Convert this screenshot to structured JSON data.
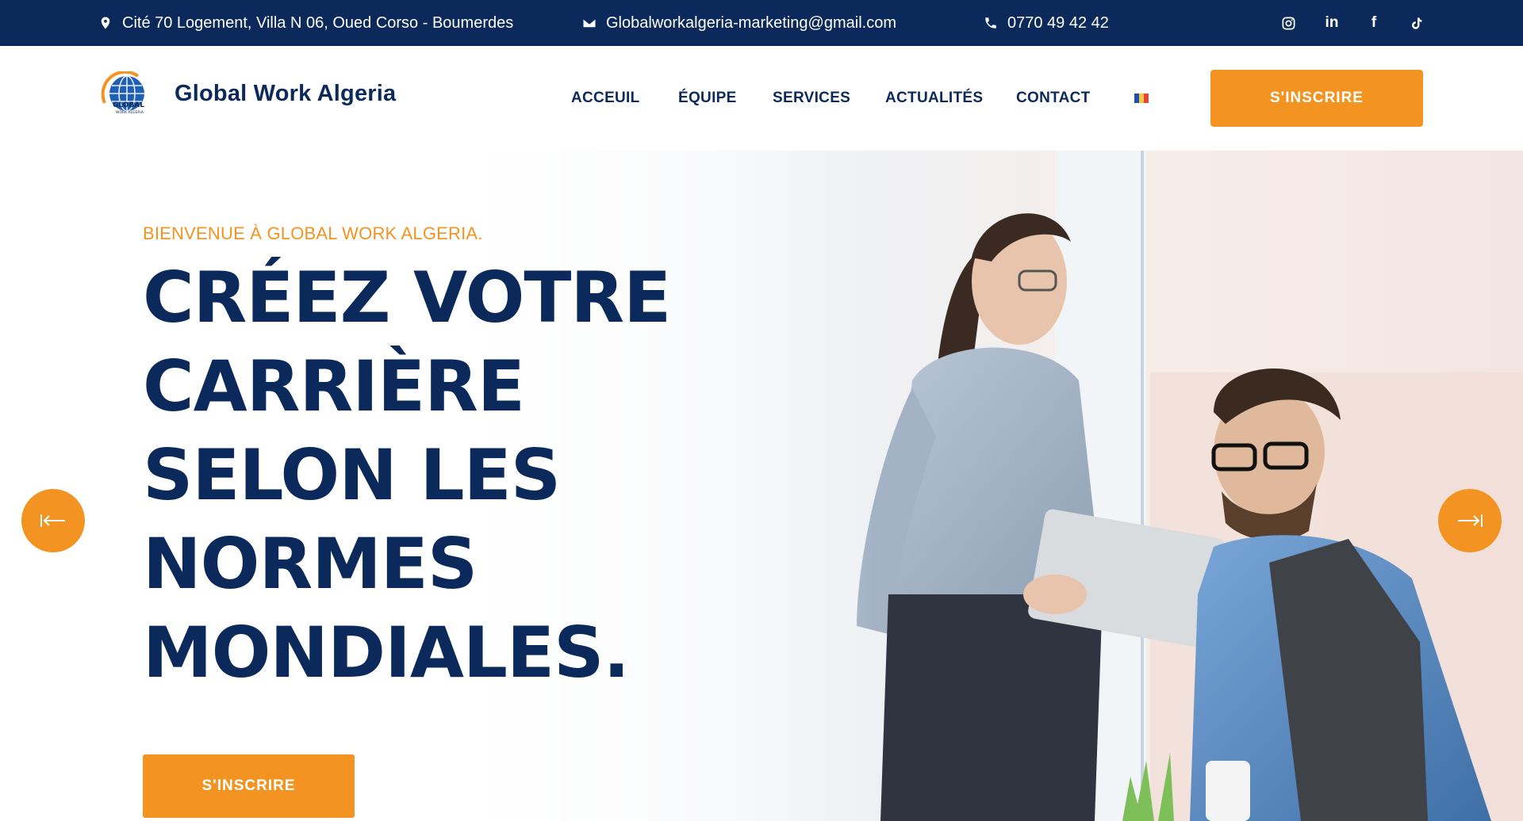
{
  "topbar": {
    "address": "Cité 70 Logement, Villa N 06, Oued Corso - Boumerdes",
    "email": "Globalworkalgeria-marketing@gmail.com",
    "phone": "0770 49 42 42",
    "socials": [
      {
        "name": "instagram-icon"
      },
      {
        "name": "linkedin-icon",
        "glyph": "in"
      },
      {
        "name": "facebook-icon",
        "glyph": "f"
      },
      {
        "name": "tiktok-icon"
      }
    ]
  },
  "header": {
    "brand": "Global Work Algeria",
    "logo_text": "GLOBAL",
    "logo_subtext": "WORK ALGERIA",
    "nav": [
      "ACCEUIL",
      "ÉQUIPE",
      "SERVICES",
      "ACTUALITÉS",
      "CONTACT"
    ],
    "language_flag": "french-flag-icon",
    "cta_label": "S'INSCRIRE"
  },
  "hero": {
    "eyebrow": "BIENVENUE À GLOBAL WORK ALGERIA.",
    "headline_lines": [
      "CRÉEZ VOTRE",
      "CARRIÈRE",
      "SELON LES",
      "NORMES",
      "MONDIALES."
    ],
    "cta_label": "S'INSCRIRE",
    "prev_icon": "arrow-left-icon",
    "next_icon": "arrow-right-icon"
  },
  "colors": {
    "navy": "#0b2a5b",
    "orange": "#f39422",
    "white": "#ffffff"
  }
}
